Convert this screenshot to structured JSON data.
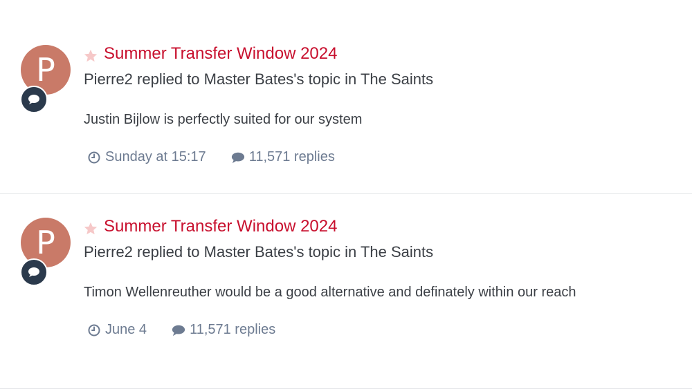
{
  "colors": {
    "title": "#c8102e",
    "avatar_bg": "#c97a68",
    "badge_bg": "#2b3a4c",
    "text": "#3b3f45",
    "meta": "#6d7b91",
    "star": "#f6c8c8"
  },
  "icons": {
    "favorite": "star-icon",
    "activity_badge": "speech-bubble-icon",
    "time": "clock-icon",
    "replies": "comment-icon"
  },
  "items": [
    {
      "avatar_letter": "P",
      "title": "Summer Transfer Window 2024",
      "subtitle": "Pierre2 replied to Master Bates's topic in The Saints",
      "snippet": "Justin Bijlow is perfectly suited for our system",
      "time": "Sunday at 15:17",
      "replies": "11,571 replies"
    },
    {
      "avatar_letter": "P",
      "title": "Summer Transfer Window 2024",
      "subtitle": "Pierre2 replied to Master Bates's topic in The Saints",
      "snippet": "Timon Wellenreuther would be a good alternative and definately within our reach",
      "time": "June 4",
      "replies": "11,571 replies"
    }
  ]
}
